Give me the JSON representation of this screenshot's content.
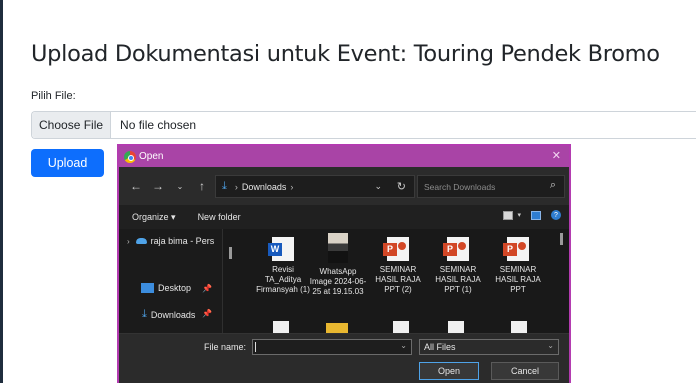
{
  "page": {
    "title": "Upload Dokumentasi untuk Event: Touring Pendek Bromo",
    "file_label": "Pilih File:",
    "choose_button": "Choose File",
    "no_file_text": "No file chosen",
    "upload_button": "Upload"
  },
  "dialog": {
    "title": "Open",
    "address_folder": "Downloads",
    "search_placeholder": "Search Downloads",
    "organize_label": "Organize",
    "new_folder_label": "New folder",
    "sidebar": [
      {
        "label": "raja bima - Pers",
        "icon": "cloud-icon"
      },
      {
        "label": "Desktop",
        "icon": "desktop-icon"
      },
      {
        "label": "Downloads",
        "icon": "downloads-icon"
      }
    ],
    "files": [
      {
        "name": "Revisi TA_Aditya Firmansyah (1)",
        "icon": "word-doc-icon"
      },
      {
        "name": "WhatsApp Image 2024-06-25 at 19.15.03",
        "icon": "image-thumbnail-icon"
      },
      {
        "name": "SEMINAR HASIL RAJA PPT (2)",
        "icon": "powerpoint-icon"
      },
      {
        "name": "SEMINAR HASIL RAJA PPT (1)",
        "icon": "powerpoint-icon"
      },
      {
        "name": "SEMINAR HASIL RAJA PPT",
        "icon": "powerpoint-icon"
      }
    ],
    "file_name_label": "File name:",
    "file_name_value": "",
    "filter_value": "All Files",
    "open_button": "Open",
    "cancel_button": "Cancel"
  },
  "colors": {
    "primary_button": "#0d6efd",
    "dialog_titlebar": "#a944a6",
    "dialog_bg": "#202020"
  }
}
